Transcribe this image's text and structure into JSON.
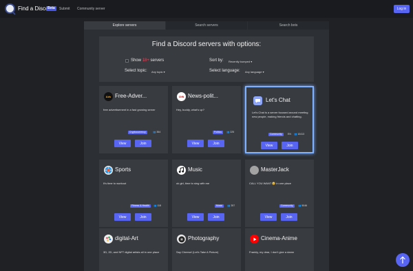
{
  "nav": {
    "brand": "Find a Discord",
    "beta": "Beta",
    "links": [
      "Submit",
      "Community server"
    ],
    "login": "Log in"
  },
  "tabs": [
    "Explore servers",
    "Search servers",
    "Search bots"
  ],
  "options": {
    "title": "Find a Discord servers with options:",
    "show_pre": "Show",
    "show_nsfw": "18+",
    "show_post": "servers",
    "sort_label": "Sort by:",
    "sort_value": "Recently bumped ▾",
    "topic_label": "Select topic:",
    "topic_value": "Any topic ▾",
    "language_label": "Select language:",
    "language_value": "Any language ▾"
  },
  "cards": [
    {
      "name": "Free-Adver...",
      "desc": "free advertisement in a fast growing server",
      "tag": "Cryptocurrency",
      "members": "👥 354",
      "lang": "",
      "view": "View",
      "join": "Join"
    },
    {
      "name": "News-polit...",
      "desc": "Hey, buddy, what's up?",
      "tag": "Politics",
      "members": "👥 225",
      "lang": "",
      "view": "View",
      "join": "Join"
    },
    {
      "name": "Let's Chat",
      "desc": "Let's Chat is a server focused around meeting new people, making friends and chatting.",
      "tag": "Community",
      "members": "👥 10413",
      "lang": "EN",
      "view": "View",
      "join": "Join"
    },
    {
      "name": "Sports",
      "desc": "It's time to workout",
      "tag": "Fitness & Health",
      "members": "👥 118",
      "lang": "",
      "view": "View",
      "join": "Join"
    },
    {
      "name": "Music",
      "desc": "ok girl, time to sing with me",
      "tag": "Music",
      "members": "👥 257",
      "lang": "",
      "view": "View",
      "join": "Join"
    },
    {
      "name": "MasterJack",
      "desc": "CALL YOU WANT 😊 in one place",
      "tag": "Community",
      "members": "👥 5046",
      "lang": "",
      "view": "View",
      "join": "Join"
    },
    {
      "name": "digital-Art",
      "desc": "3D, 2D, and NFT digital artists all in one place",
      "tag": "",
      "members": "",
      "lang": "",
      "view": "",
      "join": ""
    },
    {
      "name": "Photography",
      "desc": "Say Cheese! (Let's Take A Picture)",
      "tag": "",
      "members": "",
      "lang": "",
      "view": "",
      "join": ""
    },
    {
      "name": "Cinema-Anime",
      "desc": "Frankly, my dear, I don't give a damn",
      "tag": "",
      "members": "",
      "lang": "",
      "view": "",
      "join": ""
    }
  ],
  "icons": {
    "c0": "Ads",
    "c1": "CNN"
  },
  "colors": {
    "accent": "#5865f2",
    "nsfw": "#e8455a",
    "highlight": "#7fb3ff"
  }
}
